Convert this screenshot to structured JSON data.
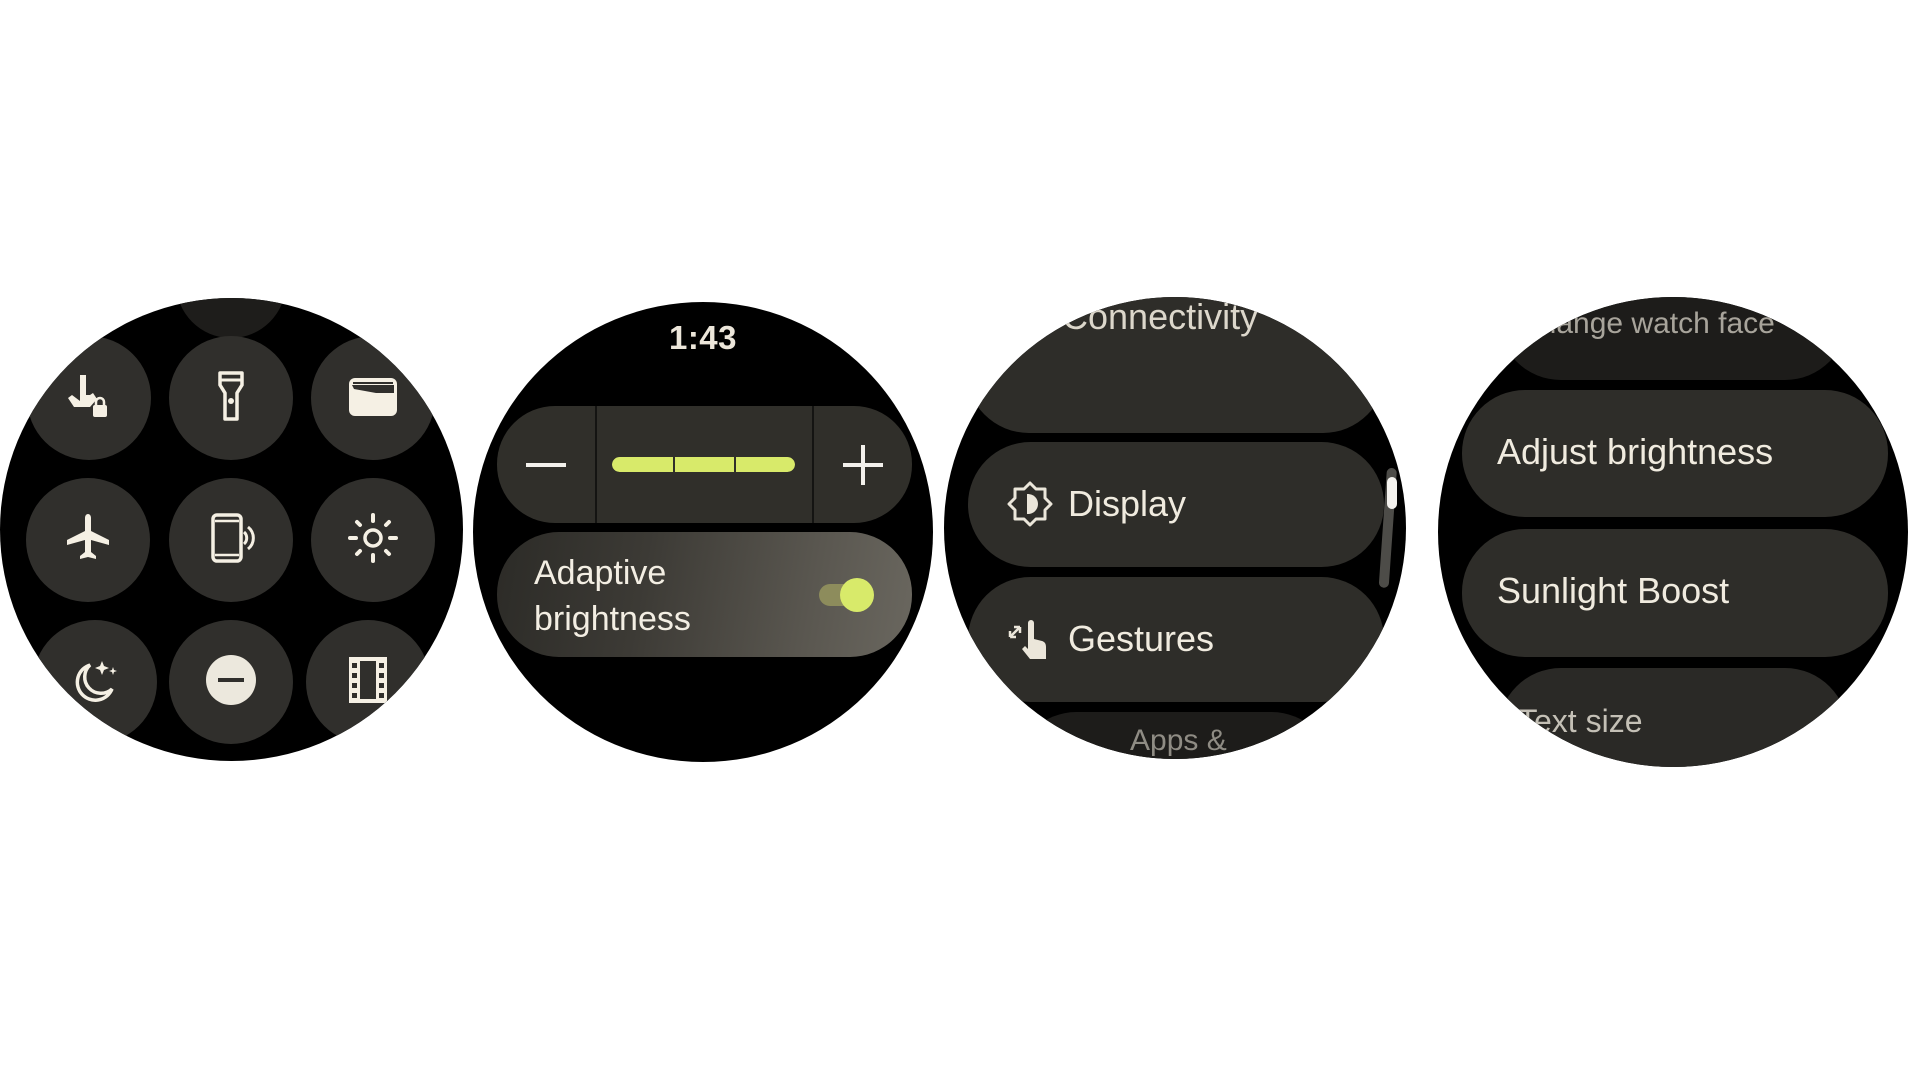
{
  "theme": {
    "accent": "#d8ea6a",
    "surface": "#302f2c",
    "foreground": "#f3eee3",
    "background": "#000000"
  },
  "watch_quick_settings": {
    "tiles": [
      {
        "icon": "touch-lock-icon",
        "label": "Touch lock"
      },
      {
        "icon": "flashlight-icon",
        "label": "Flashlight"
      },
      {
        "icon": "wallet-icon",
        "label": "Wallet"
      },
      {
        "icon": "airplane-mode-icon",
        "label": "Airplane mode"
      },
      {
        "icon": "find-my-phone-icon",
        "label": "Find my phone"
      },
      {
        "icon": "brightness-icon",
        "label": "Brightness"
      },
      {
        "icon": "bedtime-mode-icon",
        "label": "Bedtime mode"
      },
      {
        "icon": "do-not-disturb-icon",
        "label": "Do not disturb"
      },
      {
        "icon": "theater-mode-icon",
        "label": "Theater mode"
      }
    ]
  },
  "watch_brightness": {
    "time": "1:43",
    "decrease_icon": "minus-icon",
    "increase_icon": "plus-icon",
    "brightness_level": 3,
    "brightness_max": 3,
    "adaptive_label": "Adaptive brightness",
    "adaptive_enabled": true
  },
  "watch_settings": {
    "items": [
      {
        "label": "Connectivity",
        "icon": "connectivity-icon"
      },
      {
        "label": "Display",
        "icon": "display-icon"
      },
      {
        "label": "Gestures",
        "icon": "gestures-icon"
      },
      {
        "label": "Apps &",
        "icon": ""
      }
    ],
    "scroll_position": 0.1
  },
  "watch_display_settings": {
    "items": [
      {
        "label": "Change watch face"
      },
      {
        "label": "Adjust brightness"
      },
      {
        "label": "Sunlight Boost"
      },
      {
        "label": "Text size"
      }
    ]
  }
}
